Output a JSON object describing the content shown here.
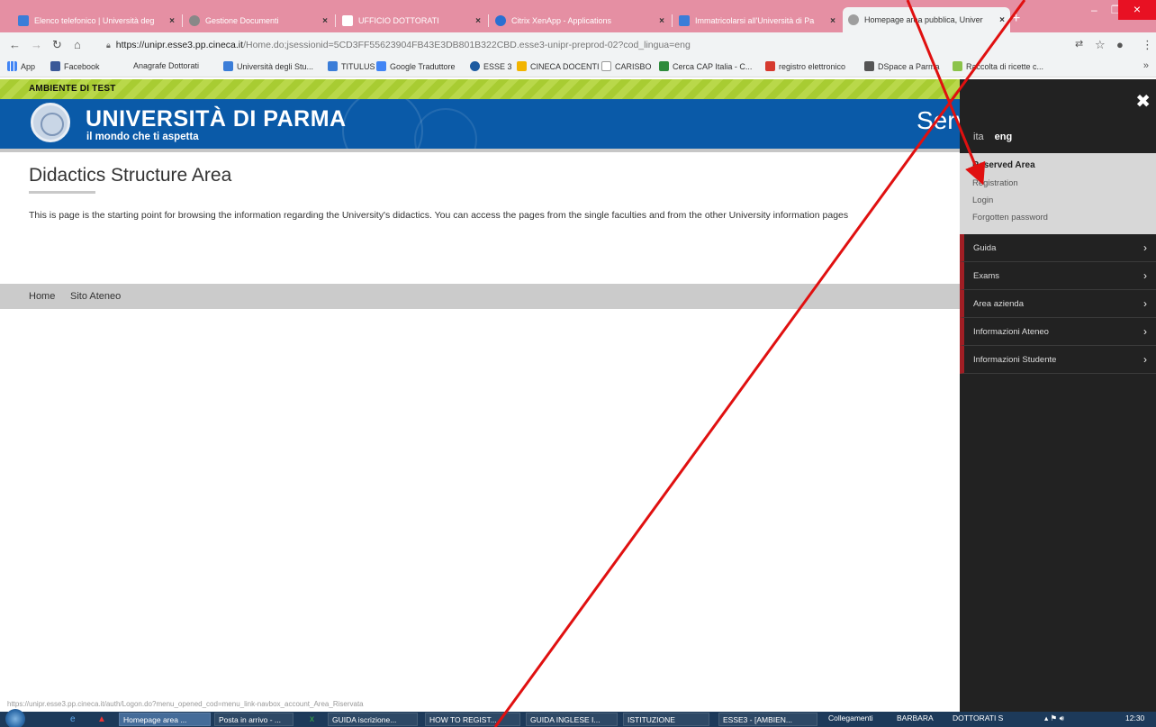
{
  "browser": {
    "tabs": [
      {
        "title": "Elenco telefonico | Università deg",
        "color": "#3b7dd8"
      },
      {
        "title": "Gestione Documenti",
        "color": "#888888"
      },
      {
        "title": "UFFICIO DOTTORATI",
        "color": "#ffffff"
      },
      {
        "title": "Citrix XenApp - Applications",
        "color": "#2a6fd1"
      },
      {
        "title": "Immatricolarsi all'Università di Pa",
        "color": "#3b7dd8"
      },
      {
        "title": "Homepage area pubblica, Univer",
        "color": "#9e9e9e"
      }
    ],
    "url_host": "https://unipr.esse3.pp.cineca.it",
    "url_path": "/Home.do;jsessionid=5CD3FF55623904FB43E3DB801B322CBD.esse3-unipr-preprod-02?cod_lingua=eng",
    "bookmarks": [
      "App",
      "Facebook",
      "Anagrafe Dottorati",
      "Università degli Stu...",
      "TITULUS",
      "Google Traduttore",
      "ESSE 3",
      "CINECA DOCENTI",
      "CARISBO",
      "Cerca CAP Italia - C...",
      "registro elettronico",
      "DSpace a Parma",
      "Raccolta di ricette c..."
    ]
  },
  "page": {
    "test_banner": "AMBIENTE DI TEST",
    "brand_title": "UNIVERSITÀ DI PARMA",
    "brand_subtitle": "il mondo che ti aspetta",
    "header_right": "Serv",
    "title": "Didactics Structure Area",
    "intro": "This is page is the starting point for browsing the information regarding the University's didactics. You can access the pages from the single faculties and from the other University information pages",
    "footer_links": [
      "Home",
      "Sito Ateneo"
    ],
    "status_url": "https://unipr.esse3.pp.cineca.it/auth/Logon.do?menu_opened_cod=menu_link-navbox_account_Area_Riservata"
  },
  "sidemenu": {
    "lang_ita": "ita",
    "lang_eng": "eng",
    "reserved_title": "Reserved Area",
    "reserved_links": [
      "Registration",
      "Login",
      "Forgotten password"
    ],
    "items": [
      "Guida",
      "Exams",
      "Area azienda",
      "Informazioni Ateneo",
      "Informazioni Studente"
    ],
    "accent_color": "#a01e24"
  },
  "taskbar": {
    "buttons": [
      "Homepage area ...",
      "Posta in arrivo - ...",
      "GUIDA iscrizione...",
      "HOW TO REGIST...",
      "GUIDA INGLESE I...",
      "ISTITUZIONE",
      "ESSE3 - [AMBIEN..."
    ],
    "tray_text": "Collegamenti",
    "tray_user1": "BARBARA",
    "tray_user2": "DOTTORATI S",
    "clock": "12:30"
  }
}
